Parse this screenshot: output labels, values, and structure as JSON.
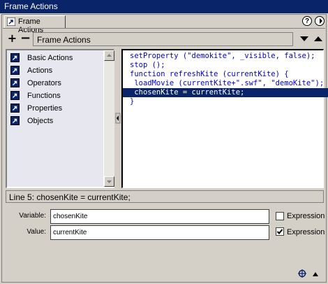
{
  "window": {
    "title": "Frame Actions"
  },
  "tab": {
    "label": "Frame Actions",
    "icon": "actions-arrow-icon"
  },
  "toolbar": {
    "add_label": "+",
    "remove_label": "−",
    "title": "Frame Actions"
  },
  "toolbox": {
    "items": [
      {
        "label": "Basic Actions",
        "icon": "action-book-icon"
      },
      {
        "label": "Actions",
        "icon": "action-book-icon"
      },
      {
        "label": "Operators",
        "icon": "action-book-icon"
      },
      {
        "label": "Functions",
        "icon": "action-book-icon"
      },
      {
        "label": "Properties",
        "icon": "action-book-icon"
      },
      {
        "label": "Objects",
        "icon": "action-book-icon"
      }
    ]
  },
  "script": {
    "lines": [
      "setProperty (\"demokite\", _visible, false);",
      "stop ();",
      "function refreshKite (currentKite) {",
      " loadMovie (currentKite+\".swf\", \"demoKite\");",
      " chosenKite = currentKite;",
      "}"
    ]
  },
  "status": {
    "text": "Line 5: chosenKite = currentKite;"
  },
  "params": {
    "variable": {
      "label": "Variable:",
      "value": "chosenKite",
      "expression_label": "Expression",
      "expression_checked": false
    },
    "value": {
      "label": "Value:",
      "value": "currentKite",
      "expression_label": "Expression",
      "expression_checked": true
    }
  },
  "colors": {
    "selection": "#0a246a",
    "code_keyword": "#0000cc",
    "panel": "#d4d0c8"
  }
}
